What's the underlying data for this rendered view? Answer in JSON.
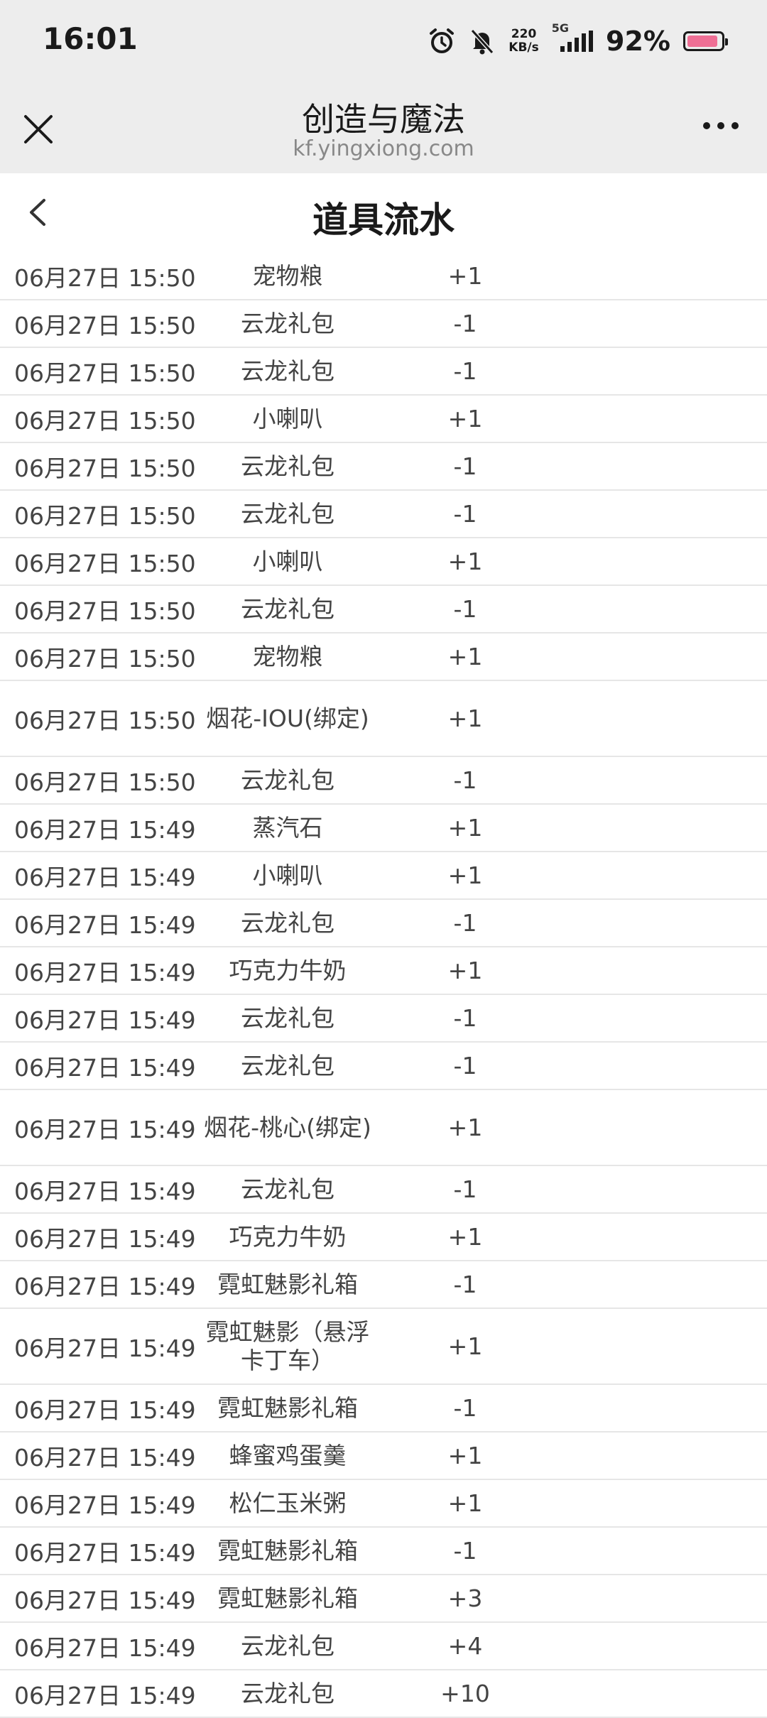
{
  "status": {
    "time": "16:01",
    "net_speed_value": "220",
    "net_speed_unit": "KB/s",
    "network": "5G",
    "battery": "92%"
  },
  "nav": {
    "title": "创造与魔法",
    "domain": "kf.yingxiong.com"
  },
  "page": {
    "title": "道具流水"
  },
  "rows": [
    {
      "time": "06月27日 15:50",
      "item": "宠物粮",
      "delta": "+1"
    },
    {
      "time": "06月27日 15:50",
      "item": "云龙礼包",
      "delta": "-1"
    },
    {
      "time": "06月27日 15:50",
      "item": "云龙礼包",
      "delta": "-1"
    },
    {
      "time": "06月27日 15:50",
      "item": "小喇叭",
      "delta": "+1"
    },
    {
      "time": "06月27日 15:50",
      "item": "云龙礼包",
      "delta": "-1"
    },
    {
      "time": "06月27日 15:50",
      "item": "云龙礼包",
      "delta": "-1"
    },
    {
      "time": "06月27日 15:50",
      "item": "小喇叭",
      "delta": "+1"
    },
    {
      "time": "06月27日 15:50",
      "item": "云龙礼包",
      "delta": "-1"
    },
    {
      "time": "06月27日 15:50",
      "item": "宠物粮",
      "delta": "+1"
    },
    {
      "time": "06月27日 15:50",
      "item": "烟花-IOU(绑定)",
      "delta": "+1"
    },
    {
      "time": "06月27日 15:50",
      "item": "云龙礼包",
      "delta": "-1"
    },
    {
      "time": "06月27日 15:49",
      "item": "蒸汽石",
      "delta": "+1"
    },
    {
      "time": "06月27日 15:49",
      "item": "小喇叭",
      "delta": "+1"
    },
    {
      "time": "06月27日 15:49",
      "item": "云龙礼包",
      "delta": "-1"
    },
    {
      "time": "06月27日 15:49",
      "item": "巧克力牛奶",
      "delta": "+1"
    },
    {
      "time": "06月27日 15:49",
      "item": "云龙礼包",
      "delta": "-1"
    },
    {
      "time": "06月27日 15:49",
      "item": "云龙礼包",
      "delta": "-1"
    },
    {
      "time": "06月27日 15:49",
      "item": "烟花-桃心(绑定)",
      "delta": "+1"
    },
    {
      "time": "06月27日 15:49",
      "item": "云龙礼包",
      "delta": "-1"
    },
    {
      "time": "06月27日 15:49",
      "item": "巧克力牛奶",
      "delta": "+1"
    },
    {
      "time": "06月27日 15:49",
      "item": "霓虹魅影礼箱",
      "delta": "-1"
    },
    {
      "time": "06月27日 15:49",
      "item": "霓虹魅影（悬浮卡丁车）",
      "delta": "+1"
    },
    {
      "time": "06月27日 15:49",
      "item": "霓虹魅影礼箱",
      "delta": "-1"
    },
    {
      "time": "06月27日 15:49",
      "item": "蜂蜜鸡蛋羹",
      "delta": "+1"
    },
    {
      "time": "06月27日 15:49",
      "item": "松仁玉米粥",
      "delta": "+1"
    },
    {
      "time": "06月27日 15:49",
      "item": "霓虹魅影礼箱",
      "delta": "-1"
    },
    {
      "time": "06月27日 15:49",
      "item": "霓虹魅影礼箱",
      "delta": "+3"
    },
    {
      "time": "06月27日 15:49",
      "item": "云龙礼包",
      "delta": "+4"
    },
    {
      "time": "06月27日 15:49",
      "item": "云龙礼包",
      "delta": "+10"
    }
  ]
}
